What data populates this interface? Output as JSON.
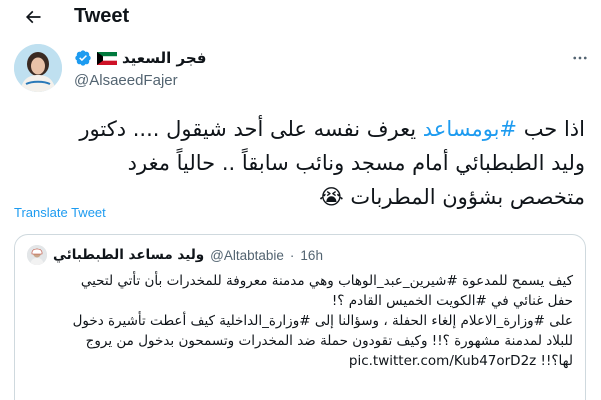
{
  "header": {
    "title": "Tweet",
    "back_icon": "arrow-left-icon"
  },
  "author": {
    "display_name": "فجر السعيد",
    "handle": "@AlsaeedFajer",
    "flag_icon": "kuwait-flag-icon",
    "verified_icon": "verified-badge-icon",
    "more_icon": "more-icon"
  },
  "tweet": {
    "line1_hashtag": "#بومساعد",
    "line1_before": "اذا حب ",
    "line1_after": " يعرف نفسه على أحد شيقول .... دكتور",
    "line2": "وليد الطبطبائي أمام مسجد ونائب سابقاً .. حالياً مغرد",
    "line3": "متخصص بشؤون المطربات",
    "emoji": "😭"
  },
  "translate_label": "Translate Tweet",
  "quote": {
    "display_name": "وليد مساعد الطبطبائي",
    "handle": "@Altabtabie",
    "dot": "·",
    "time": "16h",
    "lines": [
      "كيف يسمح للمدعوة #شيرين_عبد_الوهاب وهي مدمنة معروفة للمخدرات بأن تأتي لتحيي",
      "حفل غنائي في #الكويت الخميس القادم ؟!",
      "على #وزارة_الاعلام إلغاء الحفلة ، وسؤالنا إلى #وزارة_الداخلية كيف أعطت تأشيرة دخول",
      "للبلاد لمدمنة مشهورة ؟!! وكيف تقودون حملة ضد المخدرات وتسمحون بدخول من يروج",
      "لها؟!!"
    ],
    "link": "pic.twitter.com/Kub47orD2z"
  },
  "colors": {
    "accent": "#1d9bf0",
    "text": "#0f1419",
    "secondary": "#536471",
    "border": "#cfd9de"
  }
}
